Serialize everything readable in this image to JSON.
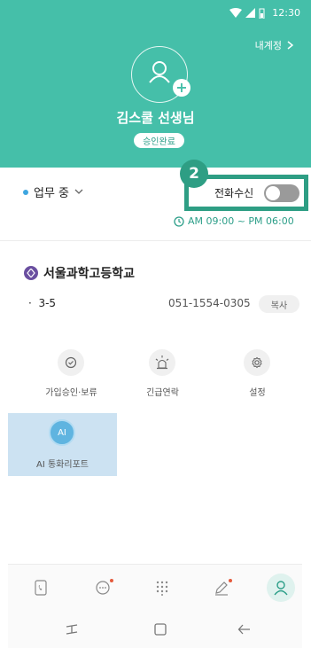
{
  "status_bar": {
    "time": "12:30"
  },
  "header": {
    "my_account": "내계정",
    "teacher_name": "김스쿨 선생님",
    "approval_badge": "승인완료"
  },
  "work": {
    "status_label": "업무 중",
    "callout_number": "2",
    "call_receive_label": "전화수신",
    "call_receive_on": false,
    "hours": "AM 09:00 ~ PM 06:00"
  },
  "school": {
    "name": "서울과학고등학교",
    "class_bullet": "·",
    "class_name": "3-5",
    "phone": "051-1554-0305",
    "copy_label": "복사"
  },
  "menu": [
    {
      "label": "가입승인·보류",
      "icon": "check-circle-icon"
    },
    {
      "label": "긴급연락",
      "icon": "siren-icon"
    },
    {
      "label": "설정",
      "icon": "gear-icon"
    }
  ],
  "ai_report": {
    "badge": "AI",
    "label": "AI 통화리포트"
  },
  "bottom_nav": [
    {
      "name": "call-log",
      "icon": "phone-book-icon",
      "dot": false
    },
    {
      "name": "messages",
      "icon": "chat-bubble-icon",
      "dot": true
    },
    {
      "name": "keypad",
      "icon": "keypad-icon",
      "dot": false
    },
    {
      "name": "notes",
      "icon": "pencil-icon",
      "dot": true
    },
    {
      "name": "profile",
      "icon": "person-icon",
      "dot": false,
      "active": true
    }
  ],
  "colors": {
    "header_bg": "#45bfa9",
    "accent": "#2e9e84",
    "ai_bg": "#cce2f2",
    "notification_dot": "#e55a3c"
  }
}
